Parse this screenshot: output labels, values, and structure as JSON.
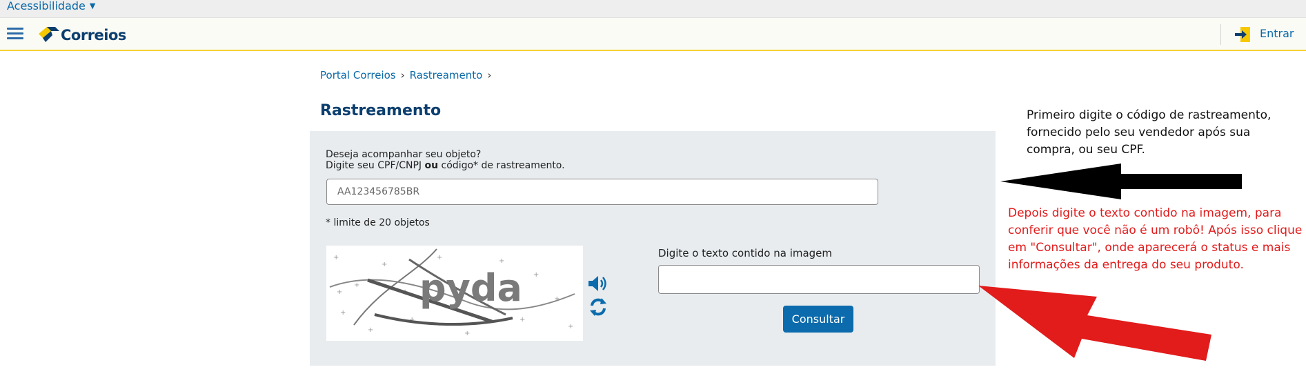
{
  "topbar": {
    "accessibility_label": "Acessibilidade"
  },
  "header": {
    "brand": "Correios",
    "login_label": "Entrar"
  },
  "breadcrumb": {
    "items": [
      "Portal Correios",
      "Rastreamento"
    ]
  },
  "page": {
    "title": "Rastreamento"
  },
  "form": {
    "prompt_line1": "Deseja acompanhar seu objeto?",
    "prompt_line2_pre": "Digite seu CPF/CNPJ ",
    "prompt_line2_bold": "ou",
    "prompt_line2_post": " código* de rastreamento.",
    "tracking_placeholder": "AA123456785BR",
    "limit_note": "* limite de 20 objetos",
    "captcha_text": "pyda",
    "captcha_label": "Digite o texto contido na imagem",
    "submit_label": "Consultar"
  },
  "annotations": {
    "step1": "Primeiro digite o código de rastreamento, fornecido pelo seu vendedor após sua compra, ou seu CPF.",
    "step2": "Depois digite o texto contido na imagem, para conferir que você não é um robô! Após isso clique em \"Consultar\", onde aparecerá o status e mais informações da entrega do seu produto."
  },
  "colors": {
    "link": "#0a6aa8",
    "brand": "#0c3f6f",
    "accent_yellow": "#f6d233",
    "button": "#0c6bac",
    "annotation_red": "#e21b1b"
  },
  "icons": [
    "caret-down-icon",
    "hamburger-icon",
    "correios-logo",
    "login-icon",
    "audio-icon",
    "refresh-icon"
  ]
}
